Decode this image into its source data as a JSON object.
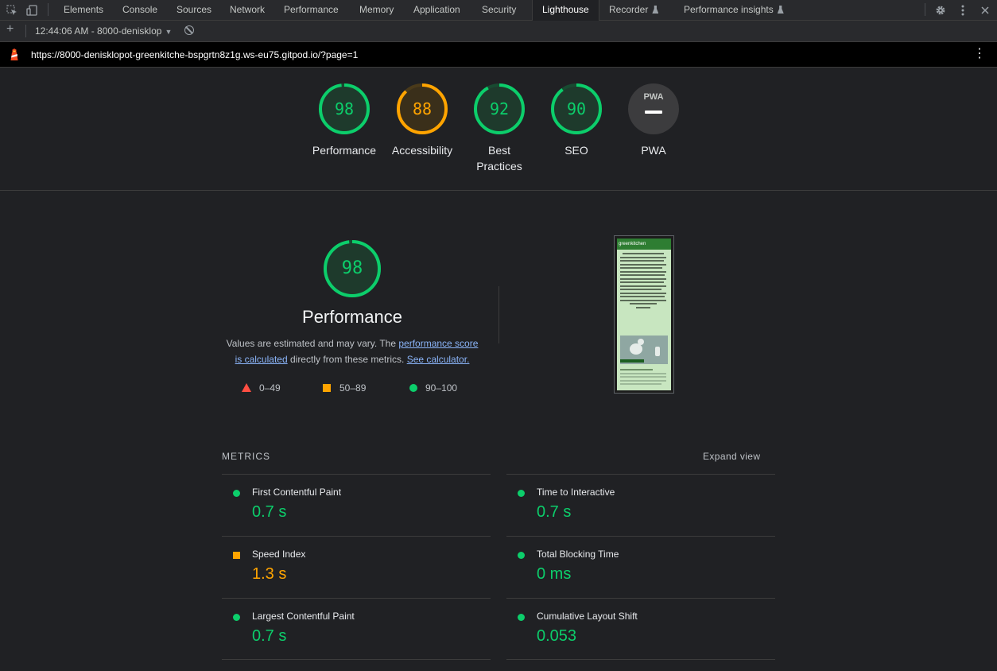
{
  "devtools": {
    "tabs": [
      "Elements",
      "Console",
      "Sources",
      "Network",
      "Performance",
      "Memory",
      "Application",
      "Security",
      "Lighthouse",
      "Recorder",
      "Performance insights"
    ],
    "active_tab": "Lighthouse",
    "icons": {
      "inspect": "inspect-element-icon",
      "device": "device-toolbar-icon",
      "settings": "gear-icon",
      "more": "kebab-menu-icon",
      "close": "close-icon"
    }
  },
  "toolbar": {
    "new_report": "+",
    "report_selector": "12:44:06 AM - 8000-denisklop",
    "clear_icon": "block-icon"
  },
  "urlbar": {
    "url": "https://8000-denisklopot-greenkitche-bspgrtn8z1g.ws-eu75.gitpod.io/?page=1",
    "menu_icon": "kebab-menu-icon"
  },
  "scores": [
    {
      "label": "Performance",
      "score": 98,
      "color": "#0cce6b"
    },
    {
      "label": "Accessibility",
      "score": 88,
      "color": "#ffa400"
    },
    {
      "label": "Best Practices",
      "label_lines": [
        "Best",
        "Practices"
      ],
      "score": 92,
      "color": "#0cce6b"
    },
    {
      "label": "SEO",
      "score": 90,
      "color": "#0cce6b"
    },
    {
      "label": "PWA",
      "badge": "PWA"
    }
  ],
  "performance": {
    "score": "98",
    "title": "Performance",
    "desc_prefix": "Values are estimated and may vary. The ",
    "desc_link": "performance score is calculated",
    "desc_middle": " directly from these metrics. ",
    "desc_link2": "See calculator.",
    "legend": [
      {
        "range": "0–49",
        "shape": "triangle",
        "color": "#ff4e42"
      },
      {
        "range": "50–89",
        "shape": "square",
        "color": "#ffa400"
      },
      {
        "range": "90–100",
        "shape": "circle",
        "color": "#0cce6b"
      }
    ],
    "thumbnail_title": "greenkitchen"
  },
  "metrics": {
    "heading": "METRICS",
    "expand": "Expand view",
    "items": [
      {
        "name": "First Contentful Paint",
        "value": "0.7 s",
        "status": "pass"
      },
      {
        "name": "Time to Interactive",
        "value": "0.7 s",
        "status": "pass"
      },
      {
        "name": "Speed Index",
        "value": "1.3 s",
        "status": "average"
      },
      {
        "name": "Total Blocking Time",
        "value": "0 ms",
        "status": "pass"
      },
      {
        "name": "Largest Contentful Paint",
        "value": "0.7 s",
        "status": "pass"
      },
      {
        "name": "Cumulative Layout Shift",
        "value": "0.053",
        "status": "pass"
      }
    ]
  }
}
